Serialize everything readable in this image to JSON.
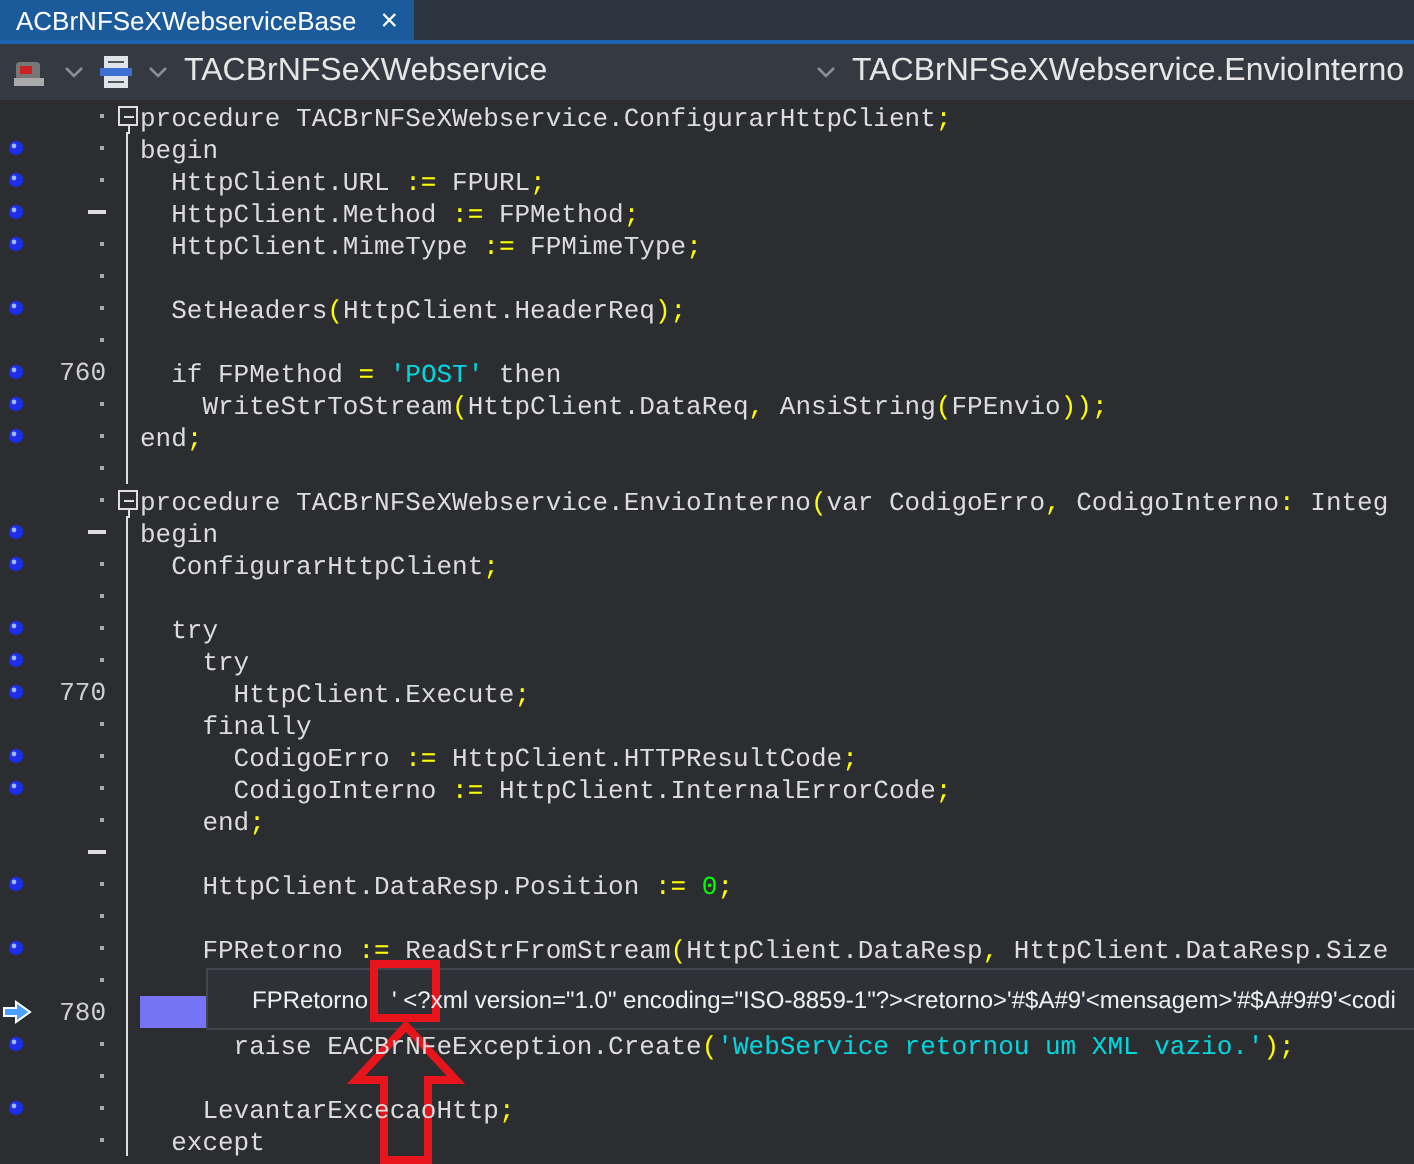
{
  "tab": {
    "label": "ACBrNFSeXWebserviceBase",
    "selected": true,
    "close": "×"
  },
  "toolbar": {
    "class_combo": "TACBrNFSeXWebservice",
    "method_combo": "TACBrNFSeXWebservice.EnvioInterno"
  },
  "lines": [
    {
      "breakpoint": false,
      "current": false,
      "fold_start": true,
      "code": "procedure TACBrNFSeXWebservice.ConfigurarHttpClient;"
    },
    {
      "breakpoint": true,
      "current": false,
      "fold_start": false,
      "code": "begin"
    },
    {
      "breakpoint": true,
      "current": false,
      "fold_start": false,
      "code": "  HttpClient.URL := FPURL;"
    },
    {
      "breakpoint": true,
      "current": false,
      "fold_start": false,
      "code": "  HttpClient.Method := FPMethod;"
    },
    {
      "breakpoint": true,
      "current": false,
      "fold_start": false,
      "code": "  HttpClient.MimeType := FPMimeType;"
    },
    {
      "breakpoint": false,
      "current": false,
      "fold_start": false
    },
    {
      "breakpoint": true,
      "current": false,
      "fold_start": false,
      "code": "  SetHeaders(HttpClient.HeaderReq);"
    },
    {
      "breakpoint": false,
      "current": false,
      "fold_start": false
    },
    {
      "number": "760",
      "breakpoint": true,
      "current": false,
      "fold_start": false,
      "code": "  if FPMethod = 'POST' then"
    },
    {
      "breakpoint": true,
      "current": false,
      "fold_start": false,
      "code": "    WriteStrToStream(HttpClient.DataReq, AnsiString(FPEnvio));"
    },
    {
      "breakpoint": true,
      "current": false,
      "fold_start": false,
      "code": "end;"
    },
    {
      "breakpoint": false,
      "current": false,
      "fold_start": false
    },
    {
      "breakpoint": false,
      "current": false,
      "fold_start": true,
      "code": "procedure TACBrNFSeXWebservice.EnvioInterno(var CodigoErro, CodigoInterno: Integ"
    },
    {
      "breakpoint": true,
      "current": false,
      "fold_start": false,
      "code": "begin"
    },
    {
      "breakpoint": true,
      "current": false,
      "fold_start": false,
      "code": "  ConfigurarHttpClient;"
    },
    {
      "breakpoint": false,
      "current": false,
      "fold_start": false
    },
    {
      "breakpoint": true,
      "current": false,
      "fold_start": false,
      "code": "  try"
    },
    {
      "breakpoint": true,
      "current": false,
      "fold_start": false,
      "code": "    try"
    },
    {
      "number": "770",
      "breakpoint": true,
      "current": false,
      "fold_start": false,
      "code": "      HttpClient.Execute;"
    },
    {
      "breakpoint": false,
      "current": false,
      "fold_start": false,
      "code": "    finally"
    },
    {
      "breakpoint": true,
      "current": false,
      "fold_start": false,
      "code": "      CodigoErro := HttpClient.HTTPResultCode;"
    },
    {
      "breakpoint": true,
      "current": false,
      "fold_start": false,
      "code": "      CodigoInterno := HttpClient.InternalErrorCode;"
    },
    {
      "breakpoint": false,
      "current": false,
      "fold_start": false,
      "code": "    end;"
    },
    {
      "breakpoint": false,
      "current": false,
      "fold_start": false
    },
    {
      "breakpoint": true,
      "current": false,
      "fold_start": false,
      "code": "    HttpClient.DataResp.Position := 0;"
    },
    {
      "breakpoint": false,
      "current": false,
      "fold_start": false
    },
    {
      "breakpoint": true,
      "current": false,
      "fold_start": false,
      "code": "    FPRetorno := ReadStrFromStream(HttpClient.DataResp, HttpClient.DataResp.Size"
    },
    {
      "breakpoint": false,
      "current": false,
      "fold_start": false
    },
    {
      "number": "780",
      "breakpoint": false,
      "current": true,
      "fold_start": false
    },
    {
      "breakpoint": true,
      "current": false,
      "fold_start": false,
      "code": "      raise EACBrNFeException.Create('WebService retornou um XML vazio.');"
    },
    {
      "breakpoint": false,
      "current": false,
      "fold_start": false
    },
    {
      "breakpoint": true,
      "current": false,
      "fold_start": false,
      "code": "    LevantarExcecaoHttp;"
    },
    {
      "breakpoint": false,
      "current": false,
      "fold_start": false,
      "code": "  except"
    }
  ],
  "tooltip": {
    "name": "FPRetorno",
    "value": "' <?xml version=\"1.0\" encoding=\"ISO-8859-1\"?><retorno>'#$A#9'<mensagem>'#$A#9#9'<codi"
  }
}
